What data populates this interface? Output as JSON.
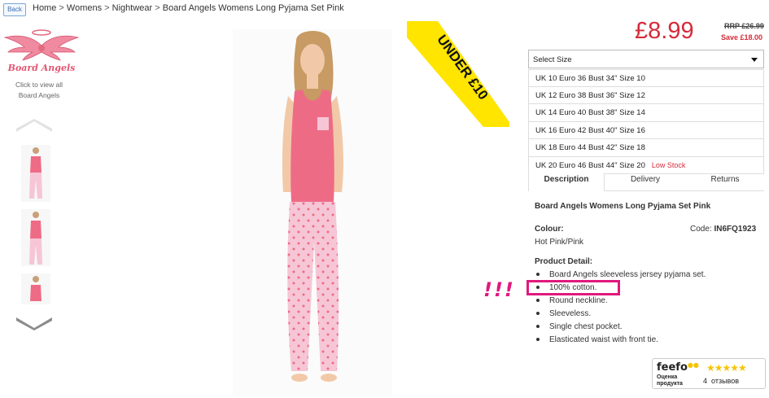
{
  "nav": {
    "back_label": "Back",
    "breadcrumb": [
      "Home",
      "Womens",
      "Nightwear",
      "Board Angels Womens Long Pyjama Set Pink"
    ],
    "separator": ">"
  },
  "brand": {
    "logo_text": "Board Angels",
    "caption_line1": "Click to view all",
    "caption_line2": "Board Angels"
  },
  "promo": {
    "ribbon_text": "UNDER £10"
  },
  "pricing": {
    "price": "£8.99",
    "rrp": "RRP £26.99",
    "save": "Save £18.00"
  },
  "size_select": {
    "label": "Select Size",
    "options": [
      {
        "label": "UK 10 Euro 36 Bust 34\" Size 10",
        "stock": ""
      },
      {
        "label": "UK 12 Euro 38 Bust 36\" Size 12",
        "stock": ""
      },
      {
        "label": "UK 14 Euro 40 Bust 38\" Size 14",
        "stock": ""
      },
      {
        "label": "UK 16 Euro 42 Bust 40\" Size 16",
        "stock": ""
      },
      {
        "label": "UK 18 Euro 44 Bust 42\" Size 18",
        "stock": ""
      },
      {
        "label": "UK 20 Euro 46 Bust 44\" Size 20",
        "stock": "Low Stock"
      }
    ]
  },
  "tabs": [
    "Description",
    "Delivery",
    "Returns"
  ],
  "description": {
    "title": "Board Angels Womens Long Pyjama Set Pink",
    "colour_heading": "Colour:",
    "colour_value": "Hot Pink/Pink",
    "code_label": "Code:",
    "code_value": "IN6FQ1923",
    "detail_heading": "Product Detail:",
    "details": [
      "Board Angels sleeveless jersey pyjama set.",
      "100% cotton.",
      "Round neckline.",
      "Sleeveless.",
      "Single chest pocket.",
      "Elasticated waist with front tie."
    ]
  },
  "annotation": {
    "exclaim": "!!!"
  },
  "feefo": {
    "logo": "feefo",
    "sub_line1": "Оценка",
    "sub_line2": "продукта",
    "stars": "★★★★★",
    "count": "4",
    "reviews_word": "отзывов"
  },
  "colors": {
    "price_red": "#d52b3a",
    "highlight_pink": "#e0197d",
    "ribbon_yellow": "#ffe500",
    "top_pink": "#ee6b86",
    "pant_pink": "#f6c6d6"
  }
}
